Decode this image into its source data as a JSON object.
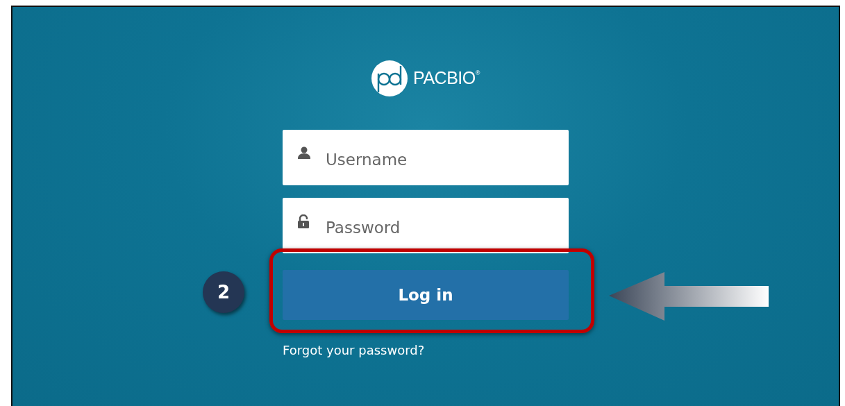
{
  "logo": {
    "wordmark": "PACBIO$^{®}$"
  },
  "fields": [
    {
      "kind": "user",
      "placeholder": "Username"
    },
    {
      "kind": "lock",
      "placeholder": "Password"
    }
  ],
  "login_button": {
    "label": "Log in"
  },
  "forgot_link": "Forgot your password?",
  "annotations": {
    "step_badge": "2"
  }
}
